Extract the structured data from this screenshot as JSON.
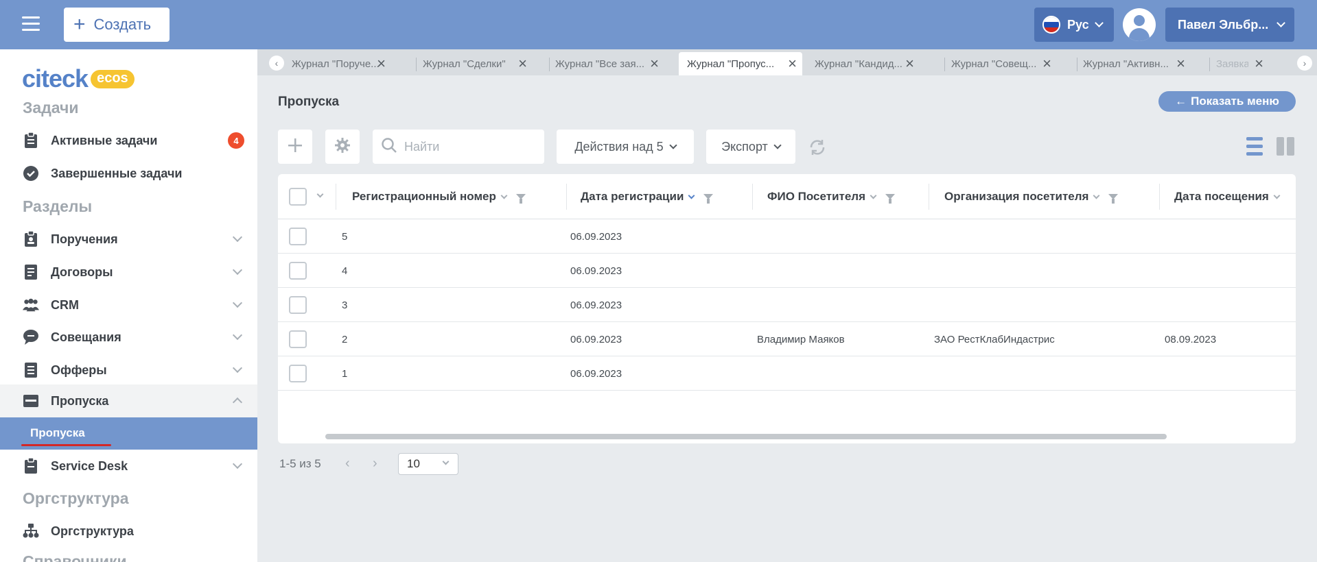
{
  "header": {
    "create_label": "Создать",
    "lang_label": "Рус",
    "user_label": "Павел Эльбр..."
  },
  "sidebar": {
    "logo_text": "citeck",
    "logo_badge": "ecos",
    "sections": {
      "tasks": "Задачи",
      "sections": "Разделы",
      "orgstructure": "Оргструктура",
      "directories": "Справочники"
    },
    "items": [
      {
        "label": "Активные задачи",
        "badge": "4"
      },
      {
        "label": "Завершенные задачи"
      },
      {
        "label": "Поручения"
      },
      {
        "label": "Договоры"
      },
      {
        "label": "CRM"
      },
      {
        "label": "Совещания"
      },
      {
        "label": "Офферы"
      },
      {
        "label": "Пропуска"
      },
      {
        "label": "Service Desk"
      },
      {
        "label": "Оргструктура"
      }
    ],
    "sub_item_label": "Пропуска"
  },
  "tabs": [
    {
      "label": "Журнал \"Поруче..."
    },
    {
      "label": "Журнал \"Сделки\""
    },
    {
      "label": "Журнал \"Все зая..."
    },
    {
      "label": "Журнал \"Пропус...",
      "active": true
    },
    {
      "label": "Журнал \"Кандид..."
    },
    {
      "label": "Журнал \"Совещ..."
    },
    {
      "label": "Журнал \"Активн..."
    },
    {
      "label": "Заявка S"
    }
  ],
  "main": {
    "title": "Пропуска",
    "show_menu_label": "Показать меню",
    "search_placeholder": "Найти",
    "actions_label": "Действия над 5",
    "export_label": "Экспорт"
  },
  "table": {
    "columns": [
      "Регистрационный номер",
      "Дата регистрации",
      "ФИО Посетителя",
      "Организация посетителя",
      "Дата посещения"
    ],
    "rows": [
      {
        "reg_no": "5",
        "reg_date": "06.09.2023",
        "visitor": "",
        "org": "",
        "visit_date": ""
      },
      {
        "reg_no": "4",
        "reg_date": "06.09.2023",
        "visitor": "",
        "org": "",
        "visit_date": ""
      },
      {
        "reg_no": "3",
        "reg_date": "06.09.2023",
        "visitor": "",
        "org": "",
        "visit_date": ""
      },
      {
        "reg_no": "2",
        "reg_date": "06.09.2023",
        "visitor": "Владимир Маяков",
        "org": "ЗАО РестКлабИндастрис",
        "visit_date": "08.09.2023"
      },
      {
        "reg_no": "1",
        "reg_date": "06.09.2023",
        "visitor": "",
        "org": "",
        "visit_date": ""
      }
    ]
  },
  "pagination": {
    "info": "1-5 из 5",
    "page_size": "10"
  },
  "colors": {
    "header_bg": "#7396cd",
    "accent_dark": "#4d72b3",
    "badge_red": "#ee4d2d",
    "logo_yellow": "#f6c431"
  }
}
